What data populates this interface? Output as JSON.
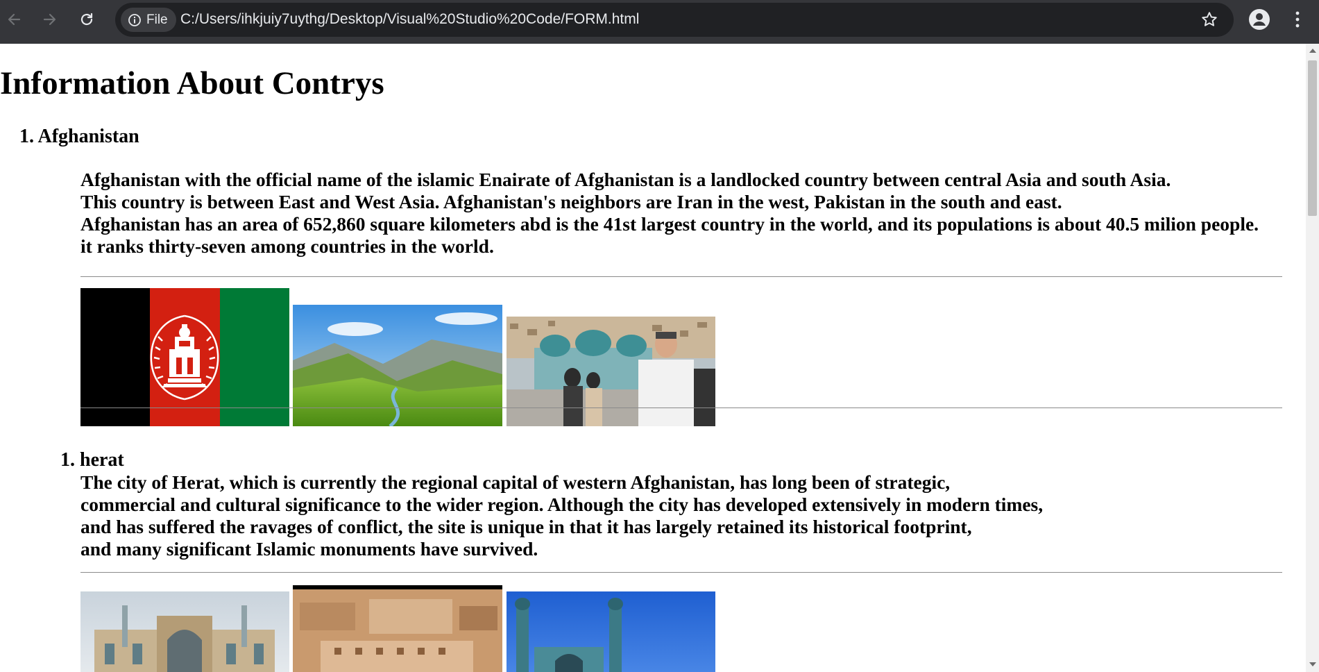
{
  "browser": {
    "site_chip_label": "File",
    "url": "C:/Users/ihkjuiy7uythg/Desktop/Visual%20Studio%20Code/FORM.html"
  },
  "page": {
    "title": "Information About Contrys",
    "country": {
      "number": "1.",
      "name": "Afghanistan",
      "paragraph_lines": [
        "Afghanistan with the official name of the islamic Enairate of Afghanistan is a landlocked country between central Asia and south Asia.",
        "This country is between East and West Asia. Afghanistan's neighbors are Iran in the west, Pakistan in the south and east.",
        "Afghanistan has an area of 652,860 square kilometers abd is the 41st largest country in the world, and its populations is about 40.5 milion people.",
        "it ranks thirty-seven among countries in the world."
      ],
      "images": [
        {
          "name": "flag-of-afghanistan"
        },
        {
          "name": "valley-landscape"
        },
        {
          "name": "blue-mosque-visitors"
        }
      ]
    },
    "city": {
      "number": "1.",
      "name": "herat",
      "paragraph_lines": [
        "The city of Herat, which is currently the regional capital of western Afghanistan, has long been of strategic,",
        "commercial and cultural significance to the wider region. Although the city has developed extensively in modern times,",
        "and has suffered the ravages of conflict, the site is unique in that it has largely retained its historical footprint,",
        "and many significant Islamic monuments have survived."
      ],
      "images": [
        {
          "name": "herat-great-mosque"
        },
        {
          "name": "herat-citadel-aerial"
        },
        {
          "name": "herat-mosque-minarets"
        }
      ]
    }
  },
  "icons": {
    "back": "arrow-left-icon",
    "forward": "arrow-right-icon",
    "reload": "reload-icon",
    "info": "info-icon",
    "bookmark": "star-icon",
    "profile": "profile-icon",
    "menu": "kebab-menu-icon"
  },
  "colors": {
    "toolbar_bg": "#35363a",
    "omnibox_bg": "#202124",
    "flag_black": "#000000",
    "flag_red": "#d32011",
    "flag_green": "#007a36"
  }
}
